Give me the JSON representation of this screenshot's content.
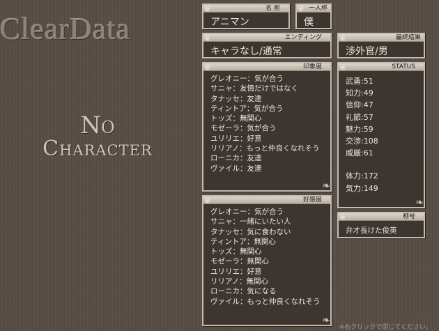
{
  "logo": {
    "text": "ClearData"
  },
  "no_character": {
    "line1": "No",
    "line2": "Character"
  },
  "name_panel": {
    "label": "名 前",
    "value": "アニマン"
  },
  "pronoun_panel": {
    "label": "一人称",
    "value": "僕"
  },
  "ending_panel": {
    "label": "エンディング",
    "value": "キャラなし/通常"
  },
  "final_result_panel": {
    "label": "最終結果",
    "value": "渉外官/男"
  },
  "impression_panel": {
    "label": "印象度",
    "items": [
      "グレオニー：気が合う",
      "サニャ：友情だけではなく",
      "タナッセ：友達",
      "ティントア：気が合う",
      "トッズ：無関心",
      "モゼーラ：気が合う",
      "ユリリエ：好意",
      "リリアノ：もっと仲良くなれそう",
      "ローニカ：友達",
      "ヴァイル：友達"
    ]
  },
  "affection_panel": {
    "label": "好感度",
    "items": [
      "グレオニー：気が合う",
      "サニャ：一緒にいたい人",
      "タナッセ：気に食わない",
      "ティントア：無関心",
      "トッズ：無関心",
      "モゼーラ：無関心",
      "ユリリエ：好意",
      "リリアノ：無関心",
      "ローニカ：気になる",
      "ヴァイル：もっと仲良くなれそう"
    ]
  },
  "status_panel": {
    "label": "STATUS",
    "items": [
      {
        "name": "武勇",
        "value": "51"
      },
      {
        "name": "知力",
        "value": "49"
      },
      {
        "name": "信仰",
        "value": "47"
      },
      {
        "name": "礼節",
        "value": "57"
      },
      {
        "name": "魅力",
        "value": "59"
      },
      {
        "name": "交渉",
        "value": "108"
      },
      {
        "name": "威厳",
        "value": "61"
      }
    ],
    "vitals": [
      {
        "name": "体力",
        "value": "172"
      },
      {
        "name": "気力",
        "value": "149"
      }
    ]
  },
  "title_panel": {
    "label": "称号",
    "value": "弁才長けた俊英"
  },
  "footer_hint": "※右クリックで閉じてください。"
}
